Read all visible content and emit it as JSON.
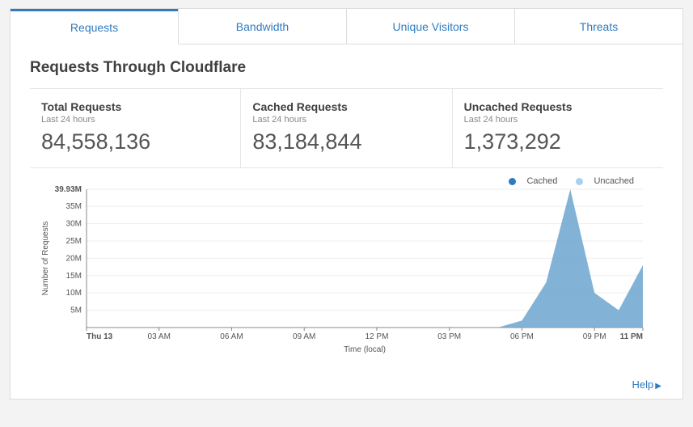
{
  "tabs": [
    {
      "label": "Requests",
      "active": true
    },
    {
      "label": "Bandwidth",
      "active": false
    },
    {
      "label": "Unique Visitors",
      "active": false
    },
    {
      "label": "Threats",
      "active": false
    }
  ],
  "section_title": "Requests Through Cloudflare",
  "stats": {
    "total": {
      "title": "Total Requests",
      "sub": "Last 24 hours",
      "value": "84,558,136"
    },
    "cached": {
      "title": "Cached Requests",
      "sub": "Last 24 hours",
      "value": "83,184,844"
    },
    "uncached": {
      "title": "Uncached Requests",
      "sub": "Last 24 hours",
      "value": "1,373,292"
    }
  },
  "legend": {
    "cached": {
      "label": "Cached",
      "color": "#2f7bbf"
    },
    "uncached": {
      "label": "Uncached",
      "color": "#a9d1ea"
    }
  },
  "footer": {
    "help": "Help"
  },
  "chart_data": {
    "type": "area",
    "xlabel": "Time (local)",
    "ylabel": "Number of Requests",
    "ylim": [
      0,
      39930000
    ],
    "y_ticks_labels": [
      "39.93M",
      "35M",
      "30M",
      "25M",
      "20M",
      "15M",
      "10M",
      "5M"
    ],
    "y_ticks_values": [
      39930000,
      35000000,
      30000000,
      25000000,
      20000000,
      15000000,
      10000000,
      5000000
    ],
    "x_categories": [
      "Thu 13",
      "03 AM",
      "06 AM",
      "09 AM",
      "12 PM",
      "03 PM",
      "06 PM",
      "09 PM",
      "11 PM"
    ],
    "x_hours": [
      0,
      3,
      6,
      9,
      12,
      15,
      18,
      21,
      23
    ],
    "series": [
      {
        "name": "Cached",
        "color": "#6ca6cf",
        "points_hours": [
          0,
          1,
          2,
          3,
          4,
          5,
          6,
          7,
          8,
          9,
          10,
          11,
          12,
          13,
          14,
          15,
          16,
          17,
          18,
          19,
          20,
          21,
          22,
          23
        ],
        "points_values": [
          0,
          0,
          0,
          0,
          0,
          0,
          0,
          0,
          0,
          0,
          0,
          0,
          0,
          0,
          0,
          0,
          0,
          0,
          2000000,
          13000000,
          39930000,
          10000000,
          5000000,
          18000000
        ]
      },
      {
        "name": "Uncached",
        "color": "#a9d1ea",
        "points_hours": [
          0,
          1,
          2,
          3,
          4,
          5,
          6,
          7,
          8,
          9,
          10,
          11,
          12,
          13,
          14,
          15,
          16,
          17,
          18,
          19,
          20,
          21,
          22,
          23
        ],
        "points_values": [
          0,
          0,
          0,
          0,
          0,
          0,
          0,
          0,
          0,
          0,
          0,
          0,
          0,
          0,
          0,
          0,
          0,
          0,
          0,
          0,
          0,
          0,
          0,
          0
        ]
      }
    ]
  }
}
